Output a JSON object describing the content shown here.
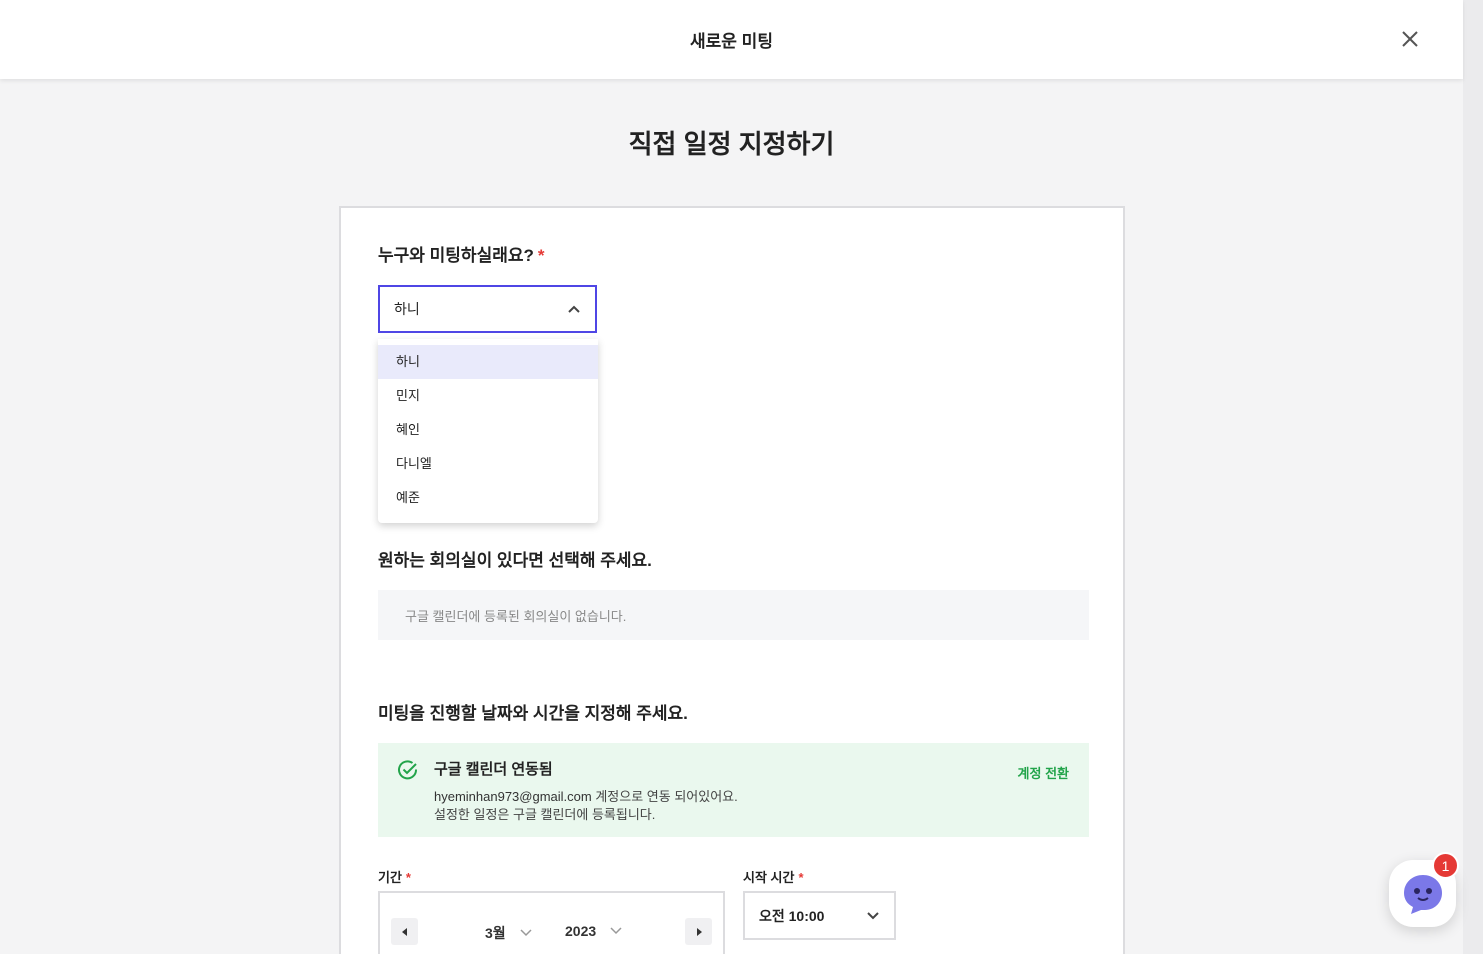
{
  "header": {
    "title": "새로운 미팅",
    "close_icon": "close-icon"
  },
  "main": {
    "title": "직접 일정 지정하기"
  },
  "attendee": {
    "label": "누구와 미팅하실래요?",
    "required_mark": "*",
    "selected": "하니",
    "options": [
      "하니",
      "민지",
      "혜인",
      "다니엘",
      "예준"
    ]
  },
  "room": {
    "label": "원하는 회의실이 있다면 선택해 주세요.",
    "empty_text": "구글 캘린더에 등록된 회의실이 없습니다."
  },
  "schedule": {
    "label": "미팅을 진행할 날짜와 시간을 지정해 주세요.",
    "gcal": {
      "title": "구글 캘린더 연동됨",
      "email": "hyeminhan973@gmail.com",
      "line1_suffix": " 계정으로 연동 되어있어요.",
      "line2": "설정한 일정은 구글 캘린더에 등록됩니다.",
      "switch_label": "계정 전환"
    },
    "period": {
      "label": "기간",
      "required_mark": "*",
      "month": "3월",
      "year": "2023"
    },
    "start_time": {
      "label": "시작 시간",
      "required_mark": "*",
      "value": "오전 10:00"
    }
  },
  "chat": {
    "badge_count": "1"
  },
  "colors": {
    "accent": "#4f46e5",
    "required": "#e53935",
    "success": "#22a44a",
    "chat": "#7b78e8"
  }
}
